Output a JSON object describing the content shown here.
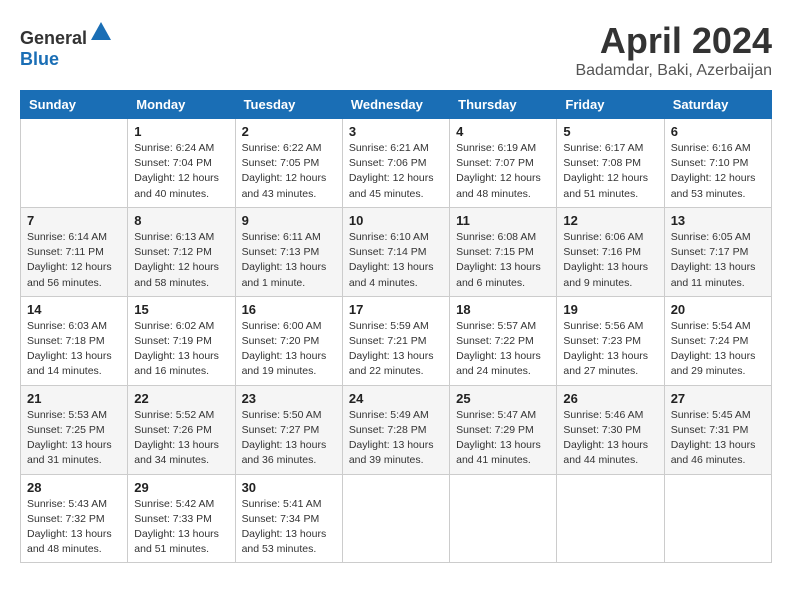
{
  "header": {
    "logo": {
      "text_general": "General",
      "text_blue": "Blue"
    },
    "title": "April 2024",
    "location": "Badamdar, Baki, Azerbaijan"
  },
  "calendar": {
    "days_of_week": [
      "Sunday",
      "Monday",
      "Tuesday",
      "Wednesday",
      "Thursday",
      "Friday",
      "Saturday"
    ],
    "weeks": [
      [
        {
          "day": "",
          "info": ""
        },
        {
          "day": "1",
          "info": "Sunrise: 6:24 AM\nSunset: 7:04 PM\nDaylight: 12 hours\nand 40 minutes."
        },
        {
          "day": "2",
          "info": "Sunrise: 6:22 AM\nSunset: 7:05 PM\nDaylight: 12 hours\nand 43 minutes."
        },
        {
          "day": "3",
          "info": "Sunrise: 6:21 AM\nSunset: 7:06 PM\nDaylight: 12 hours\nand 45 minutes."
        },
        {
          "day": "4",
          "info": "Sunrise: 6:19 AM\nSunset: 7:07 PM\nDaylight: 12 hours\nand 48 minutes."
        },
        {
          "day": "5",
          "info": "Sunrise: 6:17 AM\nSunset: 7:08 PM\nDaylight: 12 hours\nand 51 minutes."
        },
        {
          "day": "6",
          "info": "Sunrise: 6:16 AM\nSunset: 7:10 PM\nDaylight: 12 hours\nand 53 minutes."
        }
      ],
      [
        {
          "day": "7",
          "info": "Sunrise: 6:14 AM\nSunset: 7:11 PM\nDaylight: 12 hours\nand 56 minutes."
        },
        {
          "day": "8",
          "info": "Sunrise: 6:13 AM\nSunset: 7:12 PM\nDaylight: 12 hours\nand 58 minutes."
        },
        {
          "day": "9",
          "info": "Sunrise: 6:11 AM\nSunset: 7:13 PM\nDaylight: 13 hours\nand 1 minute."
        },
        {
          "day": "10",
          "info": "Sunrise: 6:10 AM\nSunset: 7:14 PM\nDaylight: 13 hours\nand 4 minutes."
        },
        {
          "day": "11",
          "info": "Sunrise: 6:08 AM\nSunset: 7:15 PM\nDaylight: 13 hours\nand 6 minutes."
        },
        {
          "day": "12",
          "info": "Sunrise: 6:06 AM\nSunset: 7:16 PM\nDaylight: 13 hours\nand 9 minutes."
        },
        {
          "day": "13",
          "info": "Sunrise: 6:05 AM\nSunset: 7:17 PM\nDaylight: 13 hours\nand 11 minutes."
        }
      ],
      [
        {
          "day": "14",
          "info": "Sunrise: 6:03 AM\nSunset: 7:18 PM\nDaylight: 13 hours\nand 14 minutes."
        },
        {
          "day": "15",
          "info": "Sunrise: 6:02 AM\nSunset: 7:19 PM\nDaylight: 13 hours\nand 16 minutes."
        },
        {
          "day": "16",
          "info": "Sunrise: 6:00 AM\nSunset: 7:20 PM\nDaylight: 13 hours\nand 19 minutes."
        },
        {
          "day": "17",
          "info": "Sunrise: 5:59 AM\nSunset: 7:21 PM\nDaylight: 13 hours\nand 22 minutes."
        },
        {
          "day": "18",
          "info": "Sunrise: 5:57 AM\nSunset: 7:22 PM\nDaylight: 13 hours\nand 24 minutes."
        },
        {
          "day": "19",
          "info": "Sunrise: 5:56 AM\nSunset: 7:23 PM\nDaylight: 13 hours\nand 27 minutes."
        },
        {
          "day": "20",
          "info": "Sunrise: 5:54 AM\nSunset: 7:24 PM\nDaylight: 13 hours\nand 29 minutes."
        }
      ],
      [
        {
          "day": "21",
          "info": "Sunrise: 5:53 AM\nSunset: 7:25 PM\nDaylight: 13 hours\nand 31 minutes."
        },
        {
          "day": "22",
          "info": "Sunrise: 5:52 AM\nSunset: 7:26 PM\nDaylight: 13 hours\nand 34 minutes."
        },
        {
          "day": "23",
          "info": "Sunrise: 5:50 AM\nSunset: 7:27 PM\nDaylight: 13 hours\nand 36 minutes."
        },
        {
          "day": "24",
          "info": "Sunrise: 5:49 AM\nSunset: 7:28 PM\nDaylight: 13 hours\nand 39 minutes."
        },
        {
          "day": "25",
          "info": "Sunrise: 5:47 AM\nSunset: 7:29 PM\nDaylight: 13 hours\nand 41 minutes."
        },
        {
          "day": "26",
          "info": "Sunrise: 5:46 AM\nSunset: 7:30 PM\nDaylight: 13 hours\nand 44 minutes."
        },
        {
          "day": "27",
          "info": "Sunrise: 5:45 AM\nSunset: 7:31 PM\nDaylight: 13 hours\nand 46 minutes."
        }
      ],
      [
        {
          "day": "28",
          "info": "Sunrise: 5:43 AM\nSunset: 7:32 PM\nDaylight: 13 hours\nand 48 minutes."
        },
        {
          "day": "29",
          "info": "Sunrise: 5:42 AM\nSunset: 7:33 PM\nDaylight: 13 hours\nand 51 minutes."
        },
        {
          "day": "30",
          "info": "Sunrise: 5:41 AM\nSunset: 7:34 PM\nDaylight: 13 hours\nand 53 minutes."
        },
        {
          "day": "",
          "info": ""
        },
        {
          "day": "",
          "info": ""
        },
        {
          "day": "",
          "info": ""
        },
        {
          "day": "",
          "info": ""
        }
      ]
    ]
  }
}
